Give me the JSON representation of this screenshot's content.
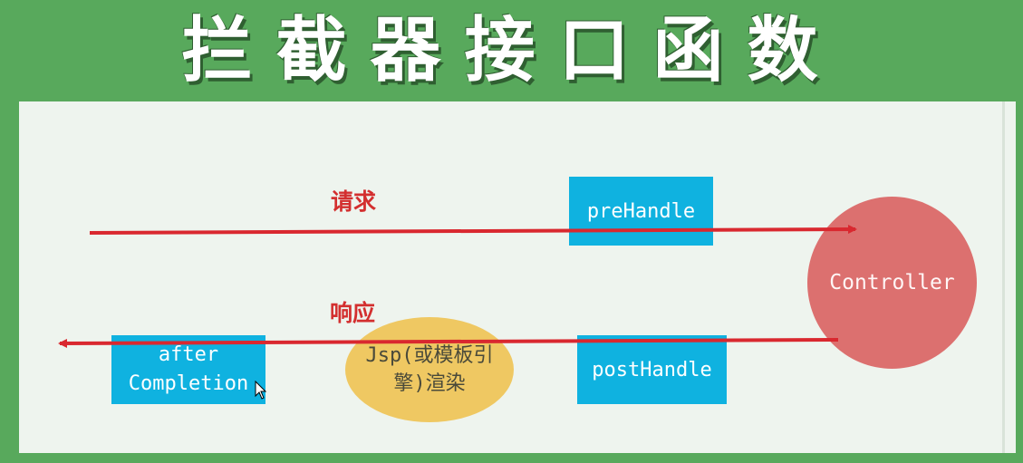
{
  "title": "拦截器接口函数",
  "labels": {
    "request": "请求",
    "response": "响应"
  },
  "nodes": {
    "pre_handle": "preHandle",
    "controller": "Controller",
    "post_handle": "postHandle",
    "render_line1": "Jsp(或模板引",
    "render_line2": "擎)渲染",
    "after_line1": "after",
    "after_line2": "Completion"
  },
  "colors": {
    "background": "#58a95c",
    "panel": "#eef4ee",
    "box": "#0fb2e0",
    "controller": "#dc706f",
    "render": "#efc862",
    "arrow": "#d9282f"
  }
}
